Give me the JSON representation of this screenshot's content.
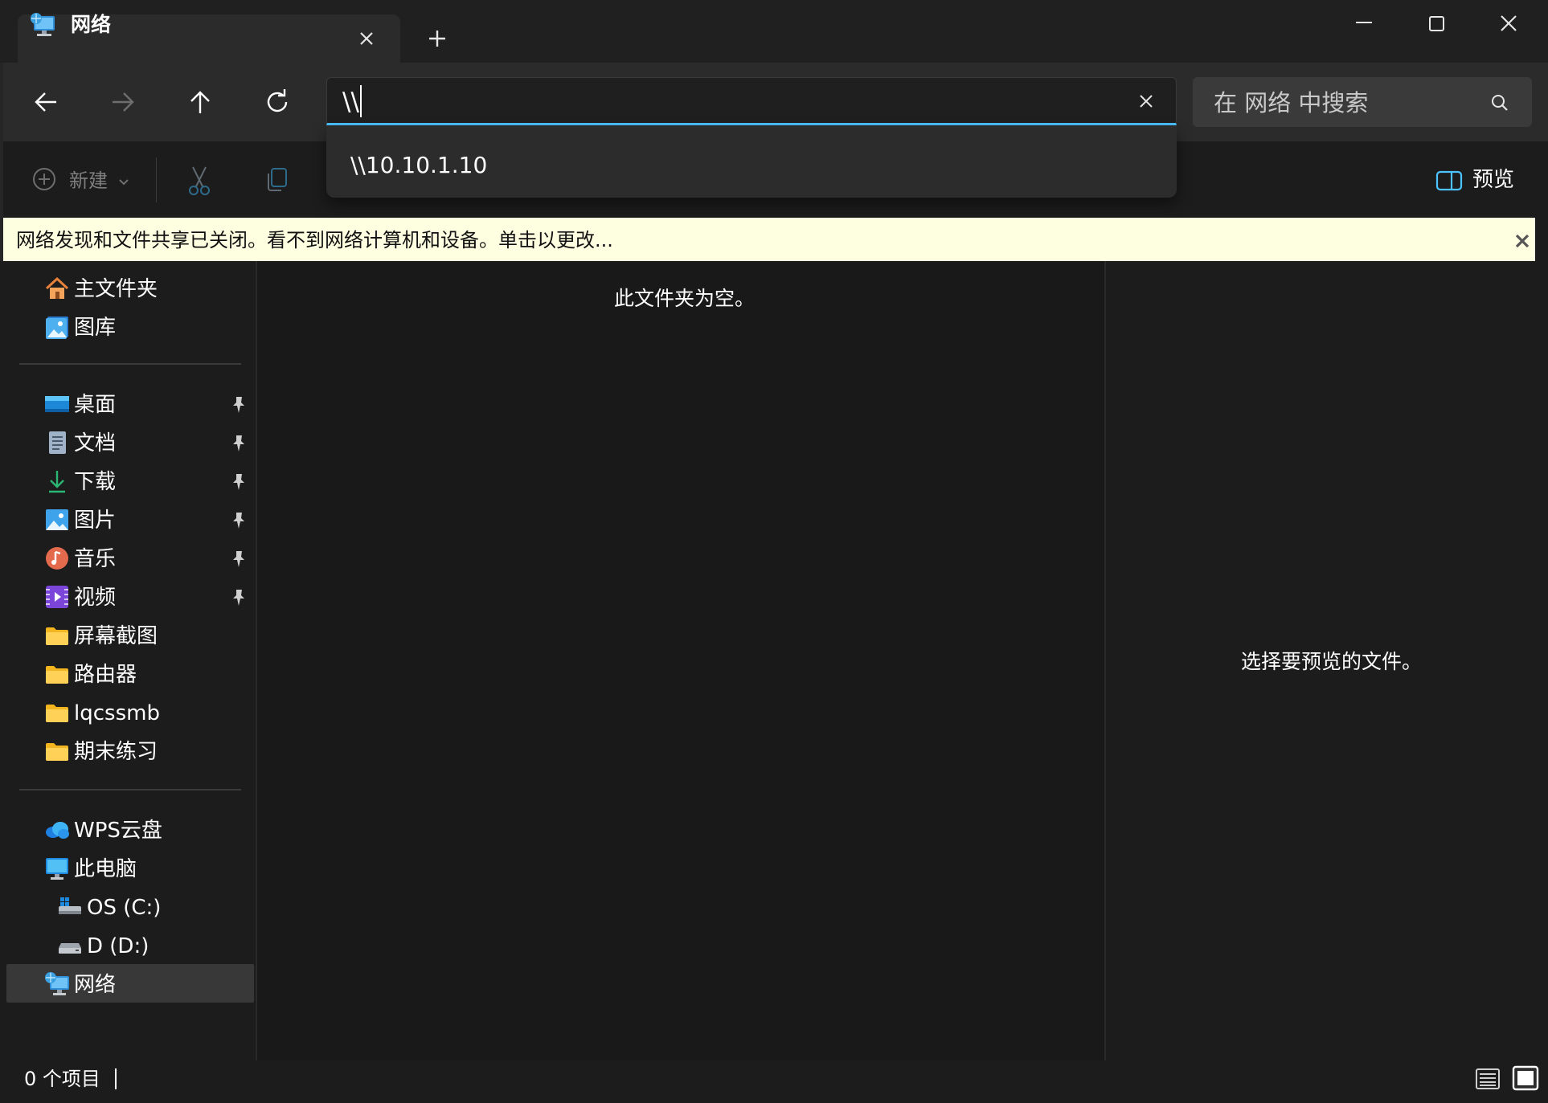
{
  "window": {
    "tab_title": "网络",
    "controls": [
      "minimize",
      "maximize",
      "close"
    ]
  },
  "navigation": {
    "address_value": "\\\\",
    "address_suggestion": "\\\\10.10.1.10",
    "search_placeholder": "在 网络 中搜索"
  },
  "commandbar": {
    "new_label": "新建",
    "preview_label": "预览"
  },
  "infobar": {
    "message": "网络发现和文件共享已关闭。看不到网络计算机和设备。单击以更改..."
  },
  "sidebar": {
    "quick": [
      {
        "label": "主文件夹",
        "icon": "home-icon"
      },
      {
        "label": "图库",
        "icon": "gallery-icon"
      }
    ],
    "pinned": [
      {
        "label": "桌面",
        "icon": "desktop-icon",
        "pinned": true
      },
      {
        "label": "文档",
        "icon": "documents-icon",
        "pinned": true
      },
      {
        "label": "下载",
        "icon": "downloads-icon",
        "pinned": true
      },
      {
        "label": "图片",
        "icon": "pictures-icon",
        "pinned": true
      },
      {
        "label": "音乐",
        "icon": "music-icon",
        "pinned": true
      },
      {
        "label": "视频",
        "icon": "videos-icon",
        "pinned": true
      },
      {
        "label": "屏幕截图",
        "icon": "folder-icon",
        "pinned": false
      },
      {
        "label": "路由器",
        "icon": "folder-icon",
        "pinned": false
      },
      {
        "label": "lqcssmb",
        "icon": "folder-icon",
        "pinned": false
      },
      {
        "label": "期末练习",
        "icon": "folder-icon",
        "pinned": false
      }
    ],
    "locations": [
      {
        "label": "WPS云盘",
        "icon": "cloud-icon"
      },
      {
        "label": "此电脑",
        "icon": "pc-icon"
      },
      {
        "label": "OS (C:)",
        "icon": "drive-c-icon"
      },
      {
        "label": "D (D:)",
        "icon": "drive-d-icon"
      },
      {
        "label": "网络",
        "icon": "network-icon",
        "selected": true
      }
    ]
  },
  "content": {
    "empty_message": "此文件夹为空。"
  },
  "preview": {
    "empty_message": "选择要预览的文件。"
  },
  "status": {
    "item_count": "0 个项目"
  },
  "colors": {
    "accent": "#4cc2ff",
    "infobar_bg": "#fefee1",
    "window_bg": "#1c1c1c",
    "selected_bg": "#383838"
  }
}
